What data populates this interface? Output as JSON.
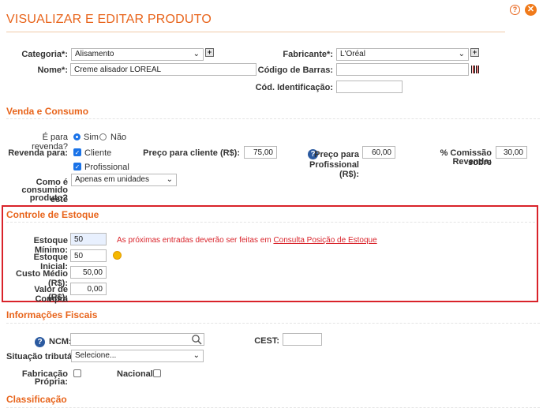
{
  "page": {
    "title": "VISUALIZAR E EDITAR PRODUTO",
    "help_glyph": "?",
    "close_glyph": "✕"
  },
  "product": {
    "categoria_label": "Categoria*:",
    "categoria_value": "Alisamento",
    "fabricante_label": "Fabricante*:",
    "fabricante_value": "L'Oréal",
    "nome_label": "Nome*:",
    "nome_value": "Creme alisador LOREAL",
    "codigo_barras_label": "Código de Barras:",
    "codigo_barras_value": "",
    "cod_ident_label": "Cód. Identificação:",
    "cod_ident_value": ""
  },
  "venda": {
    "section_title": "Venda e Consumo",
    "revenda_label": "É para revenda?",
    "sim": "Sim",
    "nao": "Não",
    "revenda_para_label": "Revenda para:",
    "cliente": "Cliente",
    "profissional": "Profissional",
    "preco_cliente_label": "Preço para cliente (R$):",
    "preco_cliente_value": "75,00",
    "preco_prof_label_1": "Preço para",
    "preco_prof_label_2": "Profissional (R$):",
    "preco_prof_value": "60,00",
    "comissao_label_1": "% Comissão sobre",
    "comissao_label_2": "Revenda:",
    "comissao_value": "30,00",
    "consumo_label_1": "Como é",
    "consumo_label_2": "consumido este",
    "consumo_label_3": "produto?",
    "consumo_value": "Apenas em unidades"
  },
  "estoque": {
    "section_title": "Controle de Estoque",
    "minimo_label": "Estoque Mínimo:",
    "minimo_value": "50",
    "aviso_text": "As próximas entradas deverão ser feitas em ",
    "aviso_link": "Consulta Posição de Estoque",
    "inicial_label": "Estoque Inicial:",
    "inicial_value": "50",
    "custo_label": "Custo Médio (R$):",
    "custo_value": "50,00",
    "compra_label_1": "Valor de Compra",
    "compra_label_2": "(R$):",
    "compra_value": "0,00"
  },
  "fiscal": {
    "section_title": "Informações Fiscais",
    "ncm_label": "NCM:",
    "ncm_value": "",
    "cest_label": "CEST:",
    "cest_value": "",
    "situacao_label": "Situação tributária:",
    "situacao_value": "Selecione...",
    "fabricacao_label_1": "Fabricação",
    "fabricacao_label_2": "Própria:",
    "nacional_label": "Nacional:"
  },
  "classificacao": {
    "section_title": "Classificação"
  },
  "icons": {
    "help": "help-circle-icon",
    "close": "close-icon",
    "add": "plus-icon",
    "barcode": "barcode-icon",
    "question": "question-icon",
    "search": "search-icon",
    "coin": "coin-icon",
    "chevron": "chevron-down-icon"
  },
  "colors": {
    "accent": "#e8641b",
    "warning": "#d9232a",
    "control_blue": "#1a73e8",
    "help_blue": "#2b5aa0"
  }
}
